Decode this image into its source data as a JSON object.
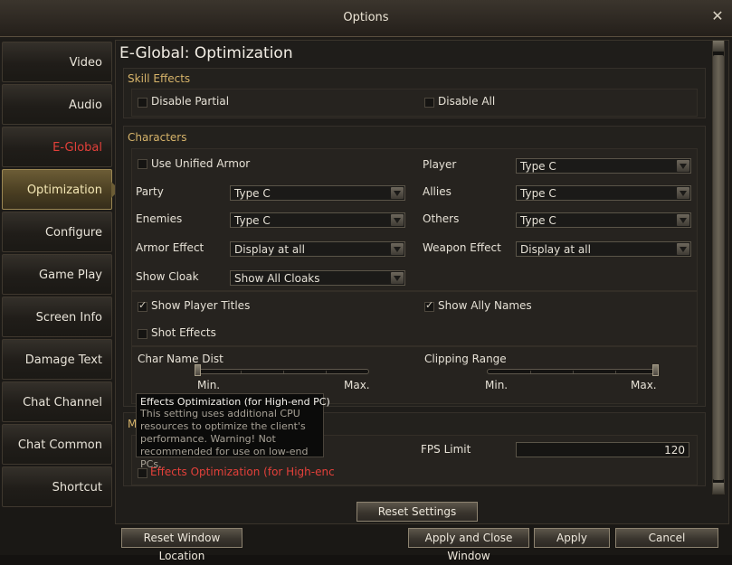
{
  "window": {
    "title": "Options",
    "close_icon": "✕"
  },
  "sidebar": {
    "items": [
      {
        "label": "Video"
      },
      {
        "label": "Audio"
      },
      {
        "label": "E-Global"
      },
      {
        "label": "Optimization"
      },
      {
        "label": "Configure"
      },
      {
        "label": "Game Play"
      },
      {
        "label": "Screen Info"
      },
      {
        "label": "Damage Text"
      },
      {
        "label": "Chat Channel"
      },
      {
        "label": "Chat Common"
      },
      {
        "label": "Shortcut"
      }
    ]
  },
  "page": {
    "title": "E-Global: Optimization"
  },
  "skill_effects": {
    "title": "Skill Effects",
    "disable_partial": {
      "label": "Disable Partial",
      "checked": false
    },
    "disable_all": {
      "label": "Disable All",
      "checked": false
    }
  },
  "characters": {
    "title": "Characters",
    "use_unified_armor": {
      "label": "Use Unified Armor",
      "checked": false
    },
    "player": {
      "label": "Player",
      "value": "Type C"
    },
    "party": {
      "label": "Party",
      "value": "Type C"
    },
    "allies": {
      "label": "Allies",
      "value": "Type C"
    },
    "enemies": {
      "label": "Enemies",
      "value": "Type C"
    },
    "others": {
      "label": "Others",
      "value": "Type C"
    },
    "armor_effect": {
      "label": "Armor Effect",
      "value": "Display at all"
    },
    "weapon_effect": {
      "label": "Weapon Effect",
      "value": "Display at all"
    },
    "show_cloak": {
      "label": "Show Cloak",
      "value": "Show All Cloaks"
    },
    "show_player_titles": {
      "label": "Show Player Titles",
      "checked": true
    },
    "show_ally_names": {
      "label": "Show Ally Names",
      "checked": true
    },
    "shot_effects": {
      "label": "Shot Effects",
      "checked": false
    },
    "char_name_dist": {
      "label": "Char Name Dist",
      "min": "Min.",
      "max": "Max.",
      "level": 0.0
    },
    "clipping_range": {
      "label": "Clipping Range",
      "min": "Min.",
      "max": "Max.",
      "level": 1.0
    }
  },
  "misc": {
    "title_partial": "M",
    "fps_limit": {
      "label": "FPS Limit",
      "value": "120"
    },
    "effects_optimization": {
      "label": "Effects Optimization (for High-enc",
      "checked": false
    }
  },
  "tooltip": {
    "title": "Effects Optimization (for High-end PC)",
    "body": "This setting uses additional CPU resources to optimize the client's performance. Warning! Not recommended for use on low-end PCs."
  },
  "buttons": {
    "reset_settings": "Reset Settings",
    "reset_window_location": "Reset Window Location",
    "apply_and_close": "Apply and Close Window",
    "apply": "Apply",
    "cancel": "Cancel"
  },
  "colors": {
    "accent_gold": "#d7b46a",
    "active_red": "#e3403a",
    "warning_red": "#e3403a"
  }
}
